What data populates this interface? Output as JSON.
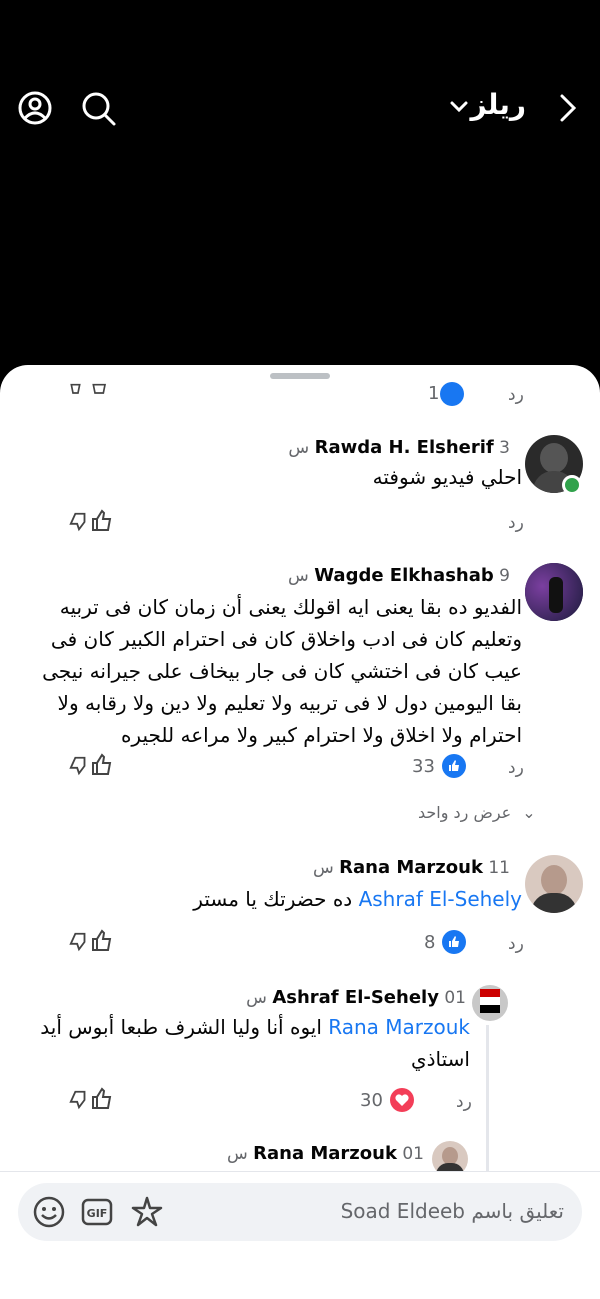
{
  "header": {
    "title": "ريلز"
  },
  "comments": [
    {
      "name": "Rawda H. Elsherif",
      "time": "3 س",
      "text": "احلي فيديو شوفته",
      "reply": "رد"
    },
    {
      "name": "Wagde Elkhashab",
      "time": "9 س",
      "text": "الفديو ده بقا يعنى ايه اقولك يعنى أن زمان كان فى تربيه وتعليم كان فى ادب واخلاق كان فى احترام الكبير كان فى عيب كان فى اختشي كان فى جار بيخاف على جيرانه نيجى بقا اليومين دول لا فى تربيه ولا تعليم ولا دين ولا رقابه ولا احترام ولا اخلاق ولا احترام كبير ولا مراعه للجيره",
      "reply": "رد",
      "likes": "33",
      "view_replies": "عرض رد واحد"
    },
    {
      "name": "Rana Marzouk",
      "time": "11 س",
      "mention": "Ashraf El-Sehely",
      "text": "ده حضرتك يا مستر",
      "reply": "رد",
      "likes": "8"
    },
    {
      "name": "Ashraf El-Sehely",
      "time": "01 س",
      "mention": "Rana Marzouk",
      "text": "ايوه أنا وليا الشرف طبعا أبوس أيد استاذي",
      "reply": "رد",
      "likes": "30"
    },
    {
      "name": "Rana Marzouk",
      "time": "01 س"
    }
  ],
  "top_partial": {
    "reply": "رد",
    "likes": "1"
  },
  "composer": {
    "placeholder": "تعليق باسم Soad Eldeeb"
  },
  "colors": {
    "mention": "#1877f2",
    "like_blue": "#1877f2",
    "love_red": "#f33e58",
    "online": "#31a24c"
  }
}
